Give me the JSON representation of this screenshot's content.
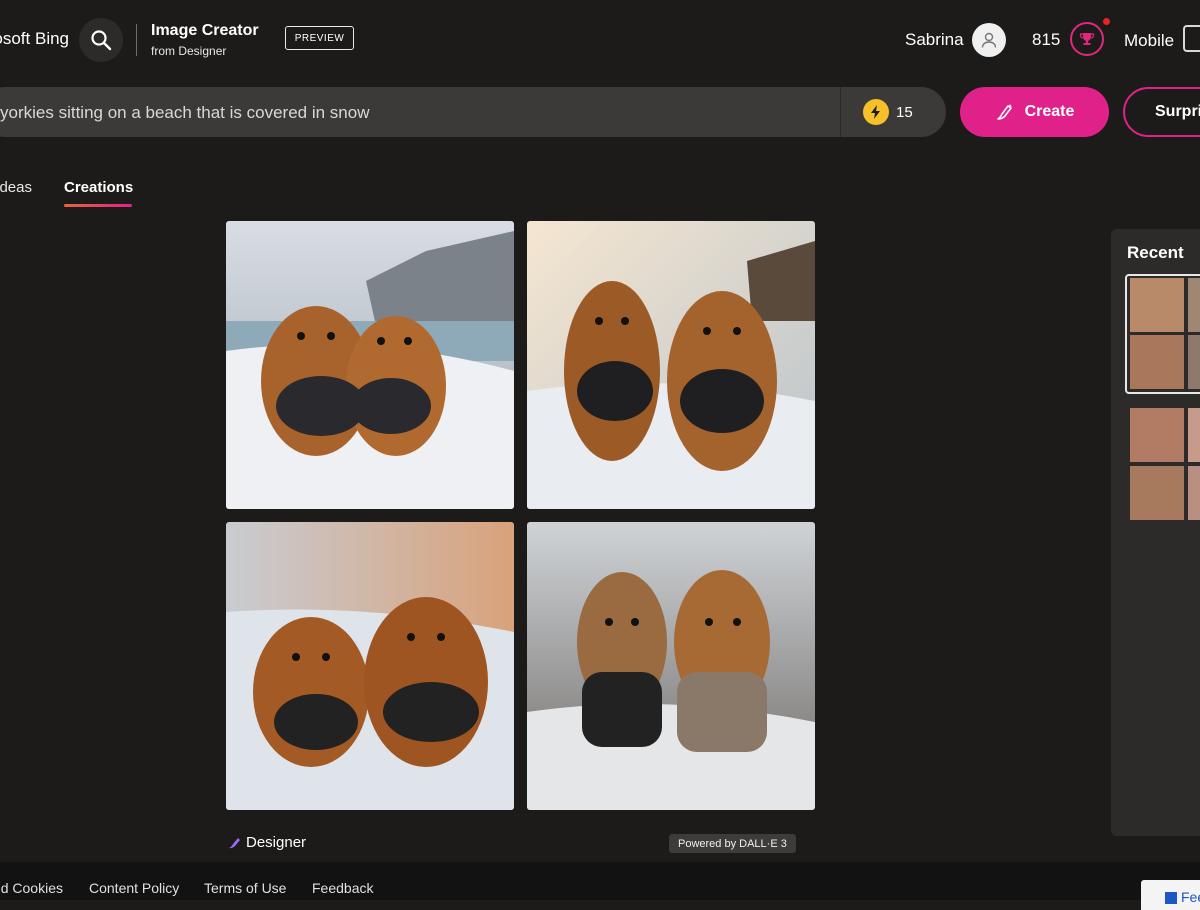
{
  "header": {
    "brand": "Microsoft Bing",
    "app_title": "Image Creator",
    "app_subtitle": "from Designer",
    "preview_badge": "PREVIEW",
    "user_name": "Sabrina",
    "points": "815",
    "mobile_label": "Mobile"
  },
  "prompt": {
    "text": "yorkies sitting on a beach that is covered in snow",
    "boosts": "15",
    "create_label": "Create",
    "surprise_label": "Surprise Me"
  },
  "tabs": {
    "ideas": "Ideas",
    "creations": "Creations"
  },
  "results": {
    "designer_label": "Designer",
    "powered_by": "Powered by DALL·E 3",
    "images": [
      "Yorkies on snowy beach 1",
      "Yorkies on snowy beach 2",
      "Yorkies on snowy beach 3",
      "Yorkies on snowy beach 4"
    ]
  },
  "recent": {
    "title": "Recent"
  },
  "footer": {
    "links": [
      "Privacy and Cookies",
      "Content Policy",
      "Terms of Use",
      "Feedback"
    ],
    "feedback_button": "Feedback"
  },
  "colors": {
    "background": "#1c1b1a",
    "accent": "#e0218a",
    "boost": "#f5c02a"
  }
}
